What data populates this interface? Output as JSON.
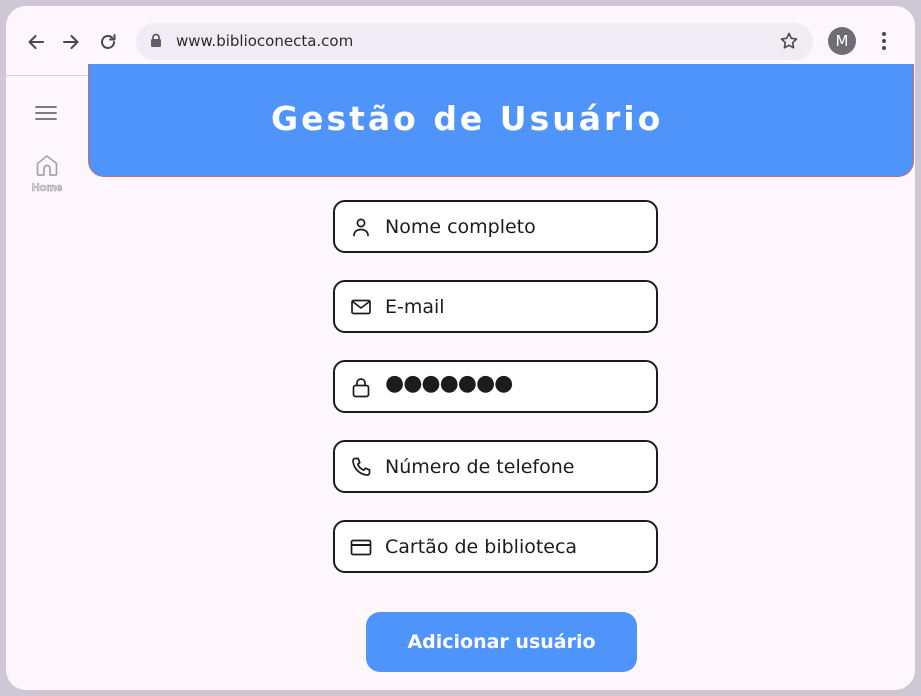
{
  "browser": {
    "url": "www.biblioconecta.com",
    "profile_initial": "M"
  },
  "rail": {
    "home_label": "Home"
  },
  "header": {
    "title": "Gestão de Usuário"
  },
  "form": {
    "name_placeholder": "Nome completo",
    "email_placeholder": "E-mail",
    "password_masked": "●●●●●●●",
    "phone_placeholder": "Número de telefone",
    "library_card_placeholder": "Cartão de biblioteca"
  },
  "actions": {
    "add_user_label": "Adicionar usuário"
  },
  "colors": {
    "accent": "#4f94fb",
    "page_background": "#fdf7fd",
    "outline": "#1d1b20"
  }
}
